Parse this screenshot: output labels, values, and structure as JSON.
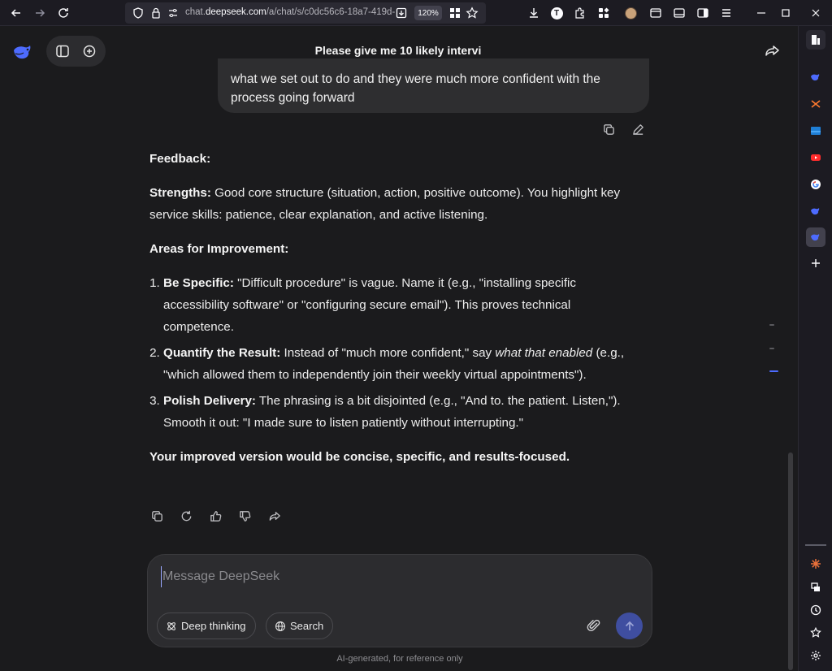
{
  "browser": {
    "url_prefix": "chat.",
    "url_domain": "deepseek.com",
    "url_path": "/a/chat/s/c0dc56c6-18a7-419d-",
    "zoom": "120%",
    "profile_initial": "T"
  },
  "header": {
    "title": "Please give me 10 likely intervi"
  },
  "user_message": {
    "line1": "what we set out to do and they were much more confident with the",
    "line2": "process going forward"
  },
  "answer": {
    "heading": "Feedback:",
    "strengths_label": "Strengths:",
    "strengths_text": " Good core structure (situation, action, positive outcome). You highlight key service skills: patience, clear explanation, and active listening.",
    "improve_heading": "Areas for Improvement:",
    "items": [
      {
        "label": "Be Specific:",
        "text": " \"Difficult procedure\" is vague. Name it (e.g., \"installing specific accessibility software\" or \"configuring secure email\"). This proves technical competence."
      },
      {
        "label": "Quantify the Result:",
        "text_before": " Instead of \"much more confident,\" say ",
        "italic": "what that enabled",
        "text_after": " (e.g., \"which allowed them to independently join their weekly virtual appointments\")."
      },
      {
        "label": "Polish Delivery:",
        "text": " The phrasing is a bit disjointed (e.g., \"And to. the patient. Listen,\"). Smooth it out: \"I made sure to listen patiently without interrupting.\""
      }
    ],
    "closing": "Your improved version would be concise, specific, and results-focused."
  },
  "composer": {
    "placeholder": "Message DeepSeek",
    "deep_thinking_label": "Deep thinking",
    "search_label": "Search"
  },
  "footer": {
    "note": "AI-generated, for reference only"
  },
  "colors": {
    "accent": "#4d6bfe",
    "send_button": "#3f4ea0",
    "background": "#1b1b1d",
    "bubble": "#2e2e30"
  }
}
